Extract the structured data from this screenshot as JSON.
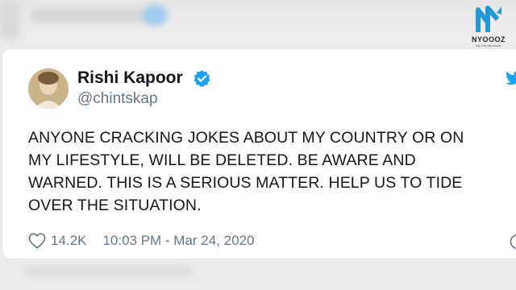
{
  "logo": {
    "name": "NYOOOZ",
    "tagline": "My City My News"
  },
  "tweet": {
    "author": {
      "name": "Rishi Kapoor",
      "handle": "@chintskap",
      "verified": true
    },
    "text_lines": [
      "ANYONE CRACKING JOKES ABOUT MY COUNTRY OR ON",
      "MY LIFESTYLE, WILL BE DELETED. BE AWARE AND",
      "WARNED. THIS IS A SERIOUS MATTER. HELP US TO TIDE",
      "OVER THE SITUATION."
    ],
    "likes": "14.2K",
    "timestamp": "10:03 PM - Mar 24, 2020"
  },
  "icons": {
    "verified": "verified-badge-icon",
    "platform": "twitter-bird-icon",
    "like": "heart-icon",
    "info": "info-icon"
  },
  "colors": {
    "verified": "#1da1f2",
    "twitter_blue": "#1da1f2",
    "text": "#14171a",
    "muted": "#657786",
    "logo_blue": "#1f9ad6"
  }
}
